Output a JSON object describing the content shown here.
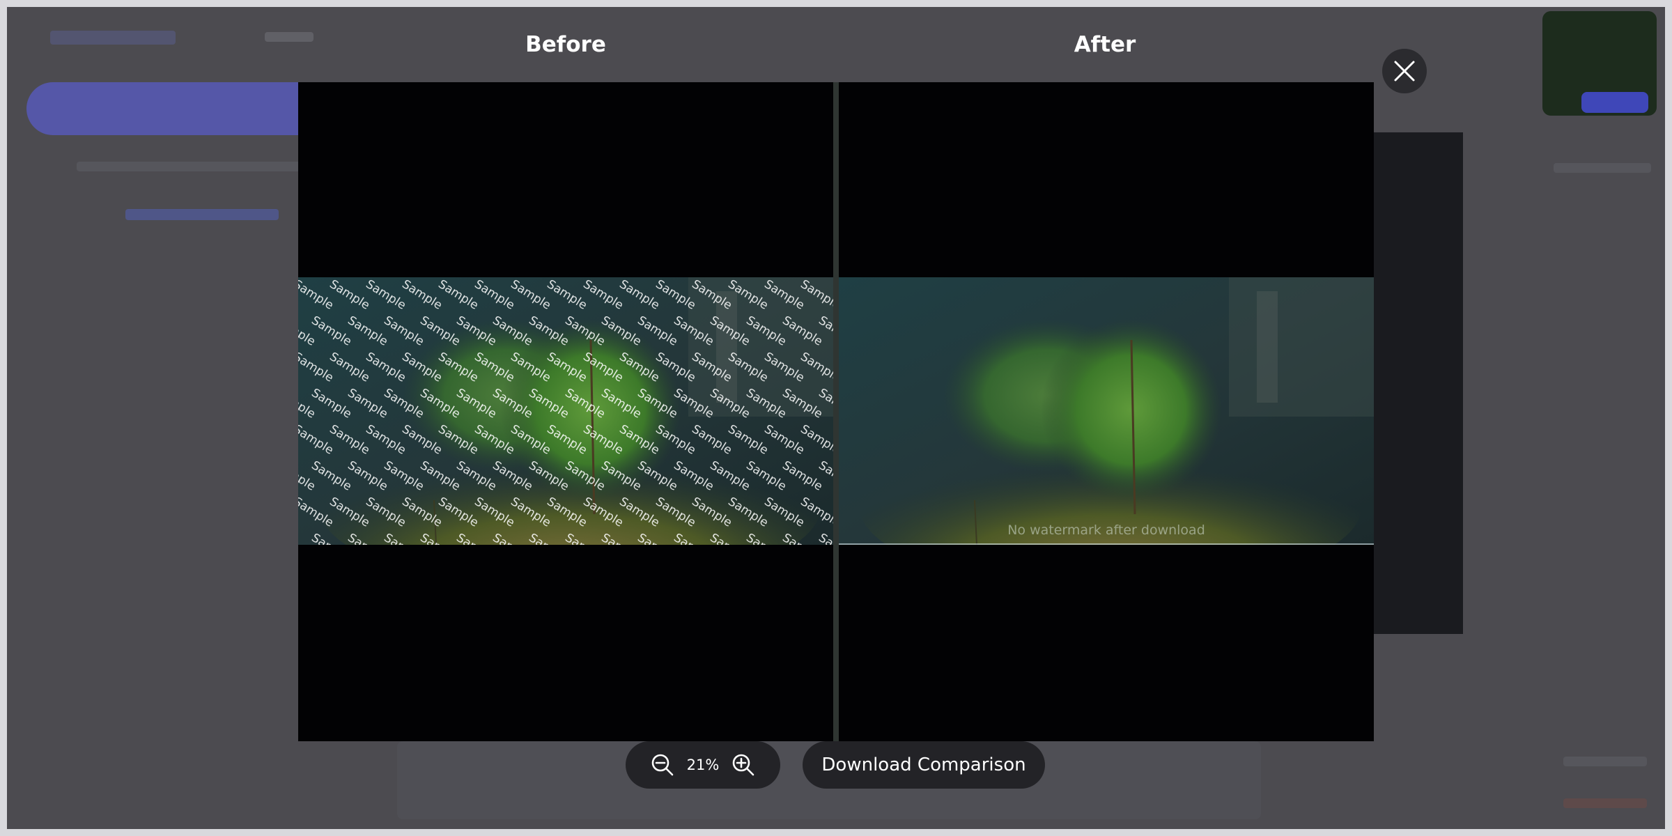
{
  "modal": {
    "before_title": "Before",
    "after_title": "After",
    "close_icon": "close-icon"
  },
  "watermark": {
    "text": "Sample"
  },
  "after_caption": "No watermark after download",
  "toolbar": {
    "zoom_level": "21%",
    "zoom_out_icon": "zoom-out-icon",
    "zoom_in_icon": "zoom-in-icon",
    "download_label": "Download Comparison"
  }
}
